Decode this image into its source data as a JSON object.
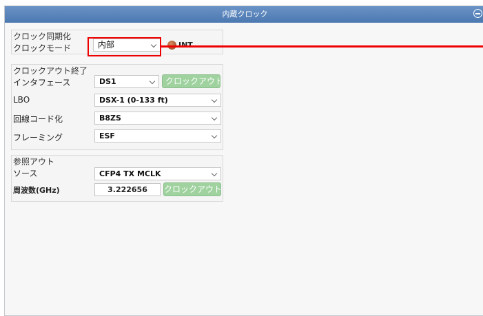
{
  "window": {
    "title": "内蔵クロック"
  },
  "clock_sync": {
    "group_title": "クロック同期化",
    "mode_label": "クロックモード",
    "mode_value": "内部",
    "status_text": "INT"
  },
  "clock_out": {
    "group_title": "クロックアウト終了",
    "interface_label": "インタフェース",
    "interface_value": "DS1",
    "clockout_end_button": "クロックアウト 終",
    "lbo_label": "LBO",
    "lbo_value": "DSX-1 (0-133 ft)",
    "line_coding_label": "回線コード化",
    "line_coding_value": "B8ZS",
    "framing_label": "フレーミング",
    "framing_value": "ESF"
  },
  "ref_out": {
    "group_title": "参照アウト",
    "source_label": "ソース",
    "source_value": "CFP4 TX MCLK",
    "frequency_label": "周波数(GHz)",
    "frequency_value": "3.222656",
    "clockout_button": "クロックアウト"
  },
  "colors": {
    "title_bar": "#5a86bd",
    "button_green": "#9fd29f",
    "highlight_red": "#e00000"
  },
  "icons": [
    "collapse-icon",
    "int-status-icon",
    "chevron-down-icon"
  ]
}
